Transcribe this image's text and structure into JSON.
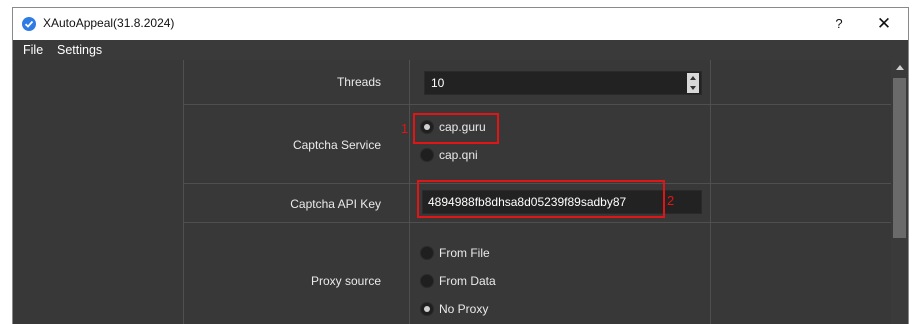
{
  "window": {
    "title": "XAutoAppeal(31.8.2024)",
    "help_label": "?",
    "close_label": "✕"
  },
  "menu": {
    "items": [
      "File",
      "Settings"
    ]
  },
  "form": {
    "threads": {
      "label": "Threads",
      "value": "10"
    },
    "captcha_service": {
      "label": "Captcha Service",
      "options": [
        {
          "label": "cap.guru",
          "checked": true
        },
        {
          "label": "cap.qni",
          "checked": false
        }
      ]
    },
    "captcha_api_key": {
      "label": "Captcha API Key",
      "value": "4894988fb8dhsa8d05239f89sadby87"
    },
    "proxy_source": {
      "label": "Proxy source",
      "options": [
        {
          "label": "From File",
          "checked": false
        },
        {
          "label": "From Data",
          "checked": false
        },
        {
          "label": "No Proxy",
          "checked": true
        }
      ]
    }
  },
  "annotations": {
    "first": "1",
    "second": "2",
    "color": "#e01515"
  },
  "icons": {
    "app": "checkmark-badge-icon",
    "close": "close-icon",
    "help": "help-icon"
  }
}
